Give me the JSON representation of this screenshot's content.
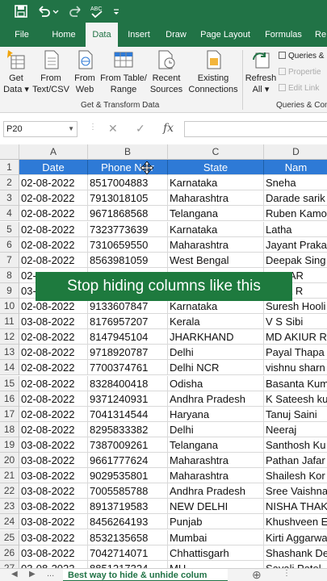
{
  "ribbon": {
    "tabs": [
      {
        "label": "File",
        "active": false
      },
      {
        "label": "Home",
        "active": false
      },
      {
        "label": "Data",
        "active": true
      },
      {
        "label": "Insert",
        "active": false
      },
      {
        "label": "Draw",
        "active": false
      },
      {
        "label": "Page Layout",
        "active": false
      },
      {
        "label": "Formulas",
        "active": false
      },
      {
        "label": "Re",
        "active": false
      }
    ],
    "buttons": {
      "get_data": "Get\nData ▾",
      "from_text_csv": "From\nText/CSV",
      "from_web": "From\nWeb",
      "from_table_range": "From Table/\nRange",
      "recent_sources": "Recent\nSources",
      "existing_connections": "Existing\nConnections",
      "refresh_all": "Refresh\nAll ▾"
    },
    "small_items": {
      "queries": "Queries &",
      "properties": "Propertie",
      "edit_links": "Edit Link"
    },
    "groups": {
      "get_transform": "Get & Transform Data",
      "queries_connections": "Queries & Con"
    }
  },
  "formula_bar": {
    "name_box": "P20",
    "fx_label": "fx",
    "formula": ""
  },
  "grid": {
    "columns": [
      "A",
      "B",
      "C",
      "D"
    ],
    "headers": [
      "Date",
      "Phone Nu r",
      "State",
      "Nam"
    ],
    "rows": [
      {
        "n": "2",
        "cells": [
          "02-08-2022",
          "8517004883",
          "Karnataka",
          "Sneha"
        ]
      },
      {
        "n": "3",
        "cells": [
          "02-08-2022",
          "7913018105",
          "Maharashtra",
          "Darade sarik"
        ]
      },
      {
        "n": "4",
        "cells": [
          "02-08-2022",
          "9671868568",
          "Telangana",
          "Ruben Kamo"
        ]
      },
      {
        "n": "5",
        "cells": [
          "02-08-2022",
          "7323773639",
          "Karnataka",
          "Latha"
        ]
      },
      {
        "n": "6",
        "cells": [
          "02-08-2022",
          "7310659550",
          "Maharashtra",
          "Jayant Praka"
        ]
      },
      {
        "n": "7",
        "cells": [
          "02-08-2022",
          "8563981059",
          "West Bengal",
          "Deepak Sing"
        ]
      },
      {
        "n": "8",
        "cells": [
          "02-",
          "",
          "",
          "KUMAR"
        ]
      },
      {
        "n": "9",
        "cells": [
          "03-",
          "",
          "",
          "l Kant R"
        ]
      },
      {
        "n": "10",
        "cells": [
          "02-08-2022",
          "9133607847",
          "Karnataka",
          "Suresh Hooli"
        ]
      },
      {
        "n": "11",
        "cells": [
          "03-08-2022",
          "8176957207",
          "Kerala",
          "V S Sibi"
        ]
      },
      {
        "n": "12",
        "cells": [
          "02-08-2022",
          "8147945104",
          "JHARKHAND",
          "MD AKIUR RA"
        ]
      },
      {
        "n": "13",
        "cells": [
          "02-08-2022",
          "9718920787",
          "Delhi",
          "Payal Thapa"
        ]
      },
      {
        "n": "14",
        "cells": [
          "02-08-2022",
          "7700374761",
          "Delhi NCR",
          "vishnu sharn"
        ]
      },
      {
        "n": "15",
        "cells": [
          "02-08-2022",
          "8328400418",
          "Odisha",
          "Basanta Kum"
        ]
      },
      {
        "n": "16",
        "cells": [
          "02-08-2022",
          "9371240931",
          "Andhra Pradesh",
          "K Sateesh ku"
        ]
      },
      {
        "n": "17",
        "cells": [
          "02-08-2022",
          "7041314544",
          "Haryana",
          "Tanuj Saini"
        ]
      },
      {
        "n": "18",
        "cells": [
          "02-08-2022",
          "8295833382",
          "Delhi",
          "Neeraj"
        ]
      },
      {
        "n": "19",
        "cells": [
          "03-08-2022",
          "7387009261",
          "Telangana",
          "Santhosh Ku"
        ]
      },
      {
        "n": "20",
        "cells": [
          "03-08-2022",
          "9661777624",
          "Maharashtra",
          "Pathan Jafar"
        ]
      },
      {
        "n": "21",
        "cells": [
          "03-08-2022",
          "9029535801",
          "Maharashtra",
          "Shailesh Kor"
        ]
      },
      {
        "n": "22",
        "cells": [
          "03-08-2022",
          "7005585788",
          "Andhra Pradesh",
          "Sree Vaishna"
        ]
      },
      {
        "n": "23",
        "cells": [
          "03-08-2022",
          "8913719583",
          "NEW DELHI",
          "NISHA THAKU"
        ]
      },
      {
        "n": "24",
        "cells": [
          "03-08-2022",
          "8456264193",
          "Punjab",
          "Khushveen E"
        ]
      },
      {
        "n": "25",
        "cells": [
          "03-08-2022",
          "8532135658",
          "Mumbai",
          "Kirti Aggarwa"
        ]
      },
      {
        "n": "26",
        "cells": [
          "03-08-2022",
          "7042714071",
          "Chhattisgarh",
          "Shashank De"
        ]
      },
      {
        "n": "27",
        "cells": [
          "03-08-2022",
          "8851217324",
          "MH",
          "Sayali Patel"
        ]
      }
    ]
  },
  "overlay_caption": "Stop hiding columns like this",
  "sheet_tab": "Best way to hide & unhide colum",
  "sheet_nav": "...",
  "colors": {
    "excel_green": "#217346",
    "header_blue": "#2e7ad6",
    "caption_green": "#1e7a3e"
  }
}
